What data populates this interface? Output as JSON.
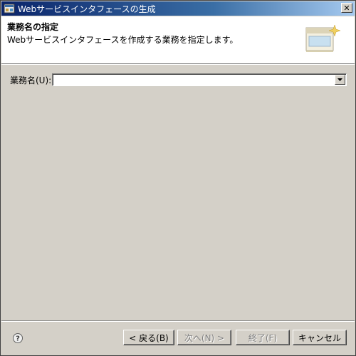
{
  "window": {
    "title": "Webサービスインタフェースの生成",
    "close_label": "✕"
  },
  "banner": {
    "title": "業務名の指定",
    "description": "Webサービスインタフェースを作成する業務を指定します。"
  },
  "form": {
    "business_name_label": "業務名(U):",
    "business_name_value": ""
  },
  "buttons": {
    "back": "< 戻る(B)",
    "next": "次へ(N) >",
    "finish": "終了(F)",
    "cancel": "キャンセル"
  },
  "help": {
    "icon": "help-icon"
  }
}
